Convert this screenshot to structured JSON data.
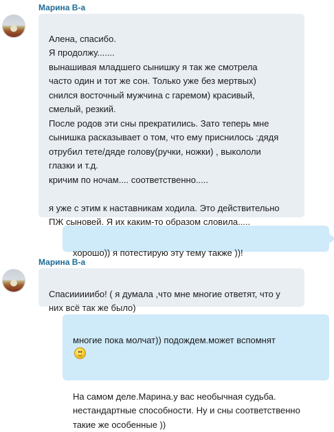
{
  "messages": [
    {
      "sender": "Марина В-а",
      "text": "Алена, спасибо.\nЯ продолжу.......\nвынашивая младшего сынишку я так же смотрела\nчасто один и тот же сон. Только уже  без мертвых)\nснился восточный мужчина с гаремом) красивый,\nсмелый, резкий.\nПосле родов эти сны прекратились. Зато теперь мне\nсынишка расказывает о том, что ему приснилось :дядя\nотрубил тете/дяде голову(ручки, ножки) , выкололи\nглазки и т.д.\nкричим по ночам.... соответственно.....\n\nя уже с этим к наставникам ходила. Это действительно\nПЖ сыновей. Я их каким-то образом словила....."
    },
    {
      "text": "хорошо)) я потестирую эту тему также ))!"
    },
    {
      "sender": "Марина В-а",
      "text": "Спасииииибо! ( я думала ,что мне многие ответят, что у\nних всё так же было)"
    },
    {
      "line1": "многие пока молчат)) подождем.может вспомнят",
      "emoji": "smiley-emoji",
      "text": "На самом деле.Марина.у вас необычная судьба.\nнестандартные способности. Ну и сны соответственно\nтакие же особенные ))"
    }
  ]
}
